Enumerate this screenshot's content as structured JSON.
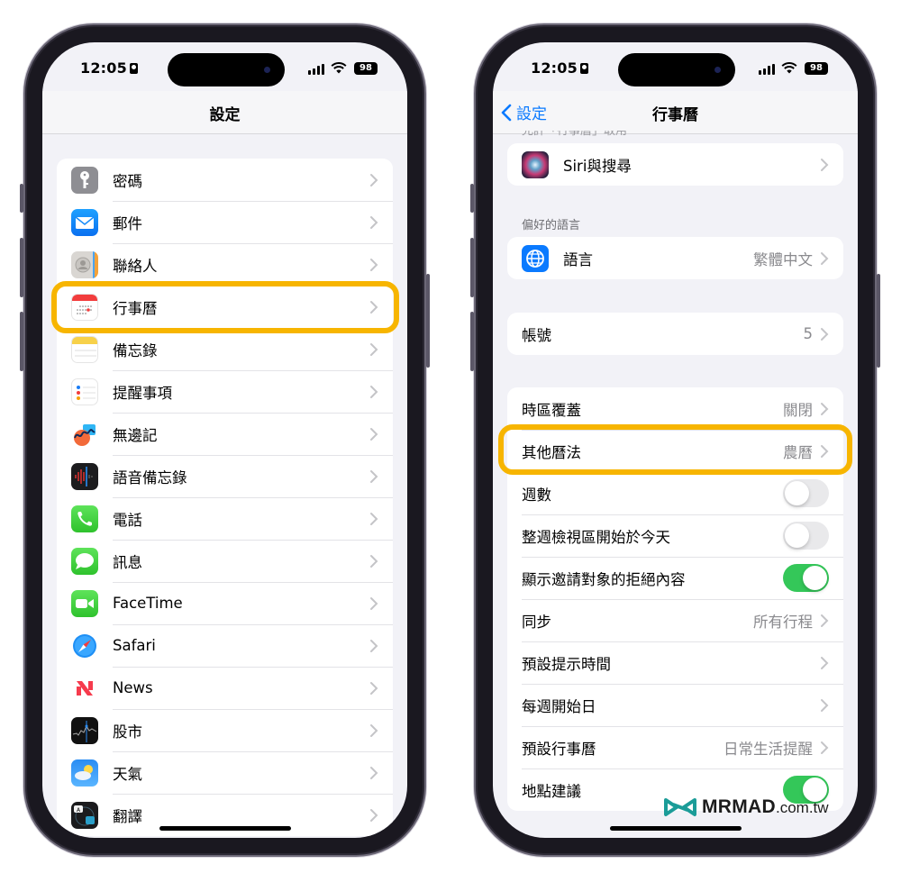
{
  "status_bar": {
    "time": "12:05",
    "battery": "98"
  },
  "left_screen": {
    "title": "設定",
    "items": [
      {
        "label": "密碼",
        "icon": "key-icon"
      },
      {
        "label": "郵件",
        "icon": "mail-icon"
      },
      {
        "label": "聯絡人",
        "icon": "contacts-icon"
      },
      {
        "label": "行事曆",
        "icon": "calendar-icon",
        "highlighted": true
      },
      {
        "label": "備忘錄",
        "icon": "notes-icon"
      },
      {
        "label": "提醒事項",
        "icon": "reminders-icon"
      },
      {
        "label": "無邊記",
        "icon": "freeform-icon"
      },
      {
        "label": "語音備忘錄",
        "icon": "voice-memos-icon"
      },
      {
        "label": "電話",
        "icon": "phone-icon"
      },
      {
        "label": "訊息",
        "icon": "messages-icon"
      },
      {
        "label": "FaceTime",
        "icon": "facetime-icon"
      },
      {
        "label": "Safari",
        "icon": "safari-icon"
      },
      {
        "label": "News",
        "icon": "news-icon"
      },
      {
        "label": "股市",
        "icon": "stocks-icon"
      },
      {
        "label": "天氣",
        "icon": "weather-icon"
      },
      {
        "label": "翻譯",
        "icon": "translate-icon"
      }
    ]
  },
  "right_screen": {
    "back_label": "設定",
    "title": "行事曆",
    "clipped_header": "允許「行事曆」取用",
    "siri": {
      "label": "Siri與搜尋",
      "icon": "siri-icon"
    },
    "language_header": "偏好的語言",
    "language": {
      "label": "語言",
      "value": "繁體中文",
      "icon": "globe-icon"
    },
    "accounts": {
      "label": "帳號",
      "value": "5"
    },
    "settings": [
      {
        "label": "時區覆蓋",
        "value": "關閉",
        "type": "link"
      },
      {
        "label": "其他曆法",
        "value": "農曆",
        "type": "link",
        "highlighted": true
      },
      {
        "label": "週數",
        "type": "toggle",
        "on": false
      },
      {
        "label": "整週檢視區開始於今天",
        "type": "toggle",
        "on": false
      },
      {
        "label": "顯示邀請對象的拒絕內容",
        "type": "toggle",
        "on": true
      },
      {
        "label": "同步",
        "value": "所有行程",
        "type": "link"
      },
      {
        "label": "預設提示時間",
        "value": "",
        "type": "link"
      },
      {
        "label": "每週開始日",
        "value": "",
        "type": "link"
      },
      {
        "label": "預設行事曆",
        "value": "日常生活提醒",
        "type": "link"
      },
      {
        "label": "地點建議",
        "type": "toggle",
        "on": true
      }
    ]
  },
  "watermark": {
    "brand": "MRMAD",
    "domain": ".com.tw"
  },
  "colors": {
    "highlight": "#f7b500",
    "accent": "#0a7aff",
    "toggle_on": "#34c759"
  }
}
